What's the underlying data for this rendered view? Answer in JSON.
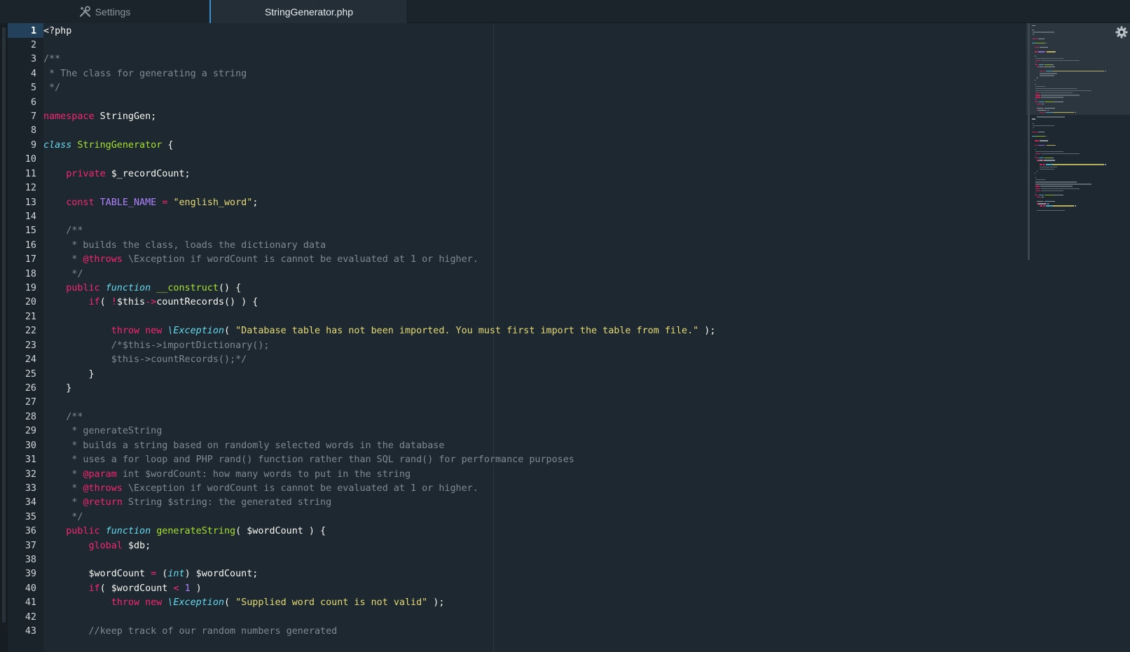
{
  "tabs": [
    {
      "label": "Settings",
      "icon": "tools-icon",
      "active": false
    },
    {
      "label": "StringGenerator.php",
      "icon": "",
      "active": true
    }
  ],
  "editor": {
    "current_line": 1,
    "line_numbers": [
      "1",
      "2",
      "3",
      "4",
      "5",
      "6",
      "7",
      "8",
      "9",
      "10",
      "11",
      "12",
      "13",
      "14",
      "15",
      "16",
      "17",
      "18",
      "19",
      "20",
      "21",
      "22",
      "23",
      "24",
      "25",
      "26",
      "27",
      "28",
      "29",
      "30",
      "31",
      "32",
      "33",
      "34",
      "35",
      "36",
      "37",
      "38",
      "39",
      "40",
      "41",
      "42",
      "43"
    ],
    "lines": [
      [
        [
          "<?php",
          "p"
        ]
      ],
      [],
      [
        [
          "/**",
          "c"
        ]
      ],
      [
        [
          " * The class for generating a string",
          "c"
        ]
      ],
      [
        [
          " */",
          "c"
        ]
      ],
      [],
      [
        [
          "namespace",
          "k"
        ],
        [
          " StringGen;",
          "p"
        ]
      ],
      [],
      [
        [
          "class",
          "it"
        ],
        [
          " ",
          "p"
        ],
        [
          "StringGenerator",
          "g"
        ],
        [
          " {",
          "p"
        ]
      ],
      [],
      [
        [
          "    ",
          "p"
        ],
        [
          "private",
          "k"
        ],
        [
          " $_recordCount;",
          "p"
        ]
      ],
      [],
      [
        [
          "    ",
          "p"
        ],
        [
          "const",
          "k"
        ],
        [
          " ",
          "p"
        ],
        [
          "TABLE_NAME",
          "n"
        ],
        [
          " ",
          "p"
        ],
        [
          "=",
          "k"
        ],
        [
          " ",
          "p"
        ],
        [
          "\"english_word\"",
          "s"
        ],
        [
          ";",
          "p"
        ]
      ],
      [],
      [
        [
          "    /**",
          "c"
        ]
      ],
      [
        [
          "     * builds the class, loads the dictionary data",
          "c"
        ]
      ],
      [
        [
          "     * ",
          "c"
        ],
        [
          "@throws",
          "k"
        ],
        [
          " \\Exception if wordCount is cannot be evaluated at 1 or higher.",
          "c"
        ]
      ],
      [
        [
          "     */",
          "c"
        ]
      ],
      [
        [
          "    ",
          "p"
        ],
        [
          "public",
          "k"
        ],
        [
          " ",
          "p"
        ],
        [
          "function",
          "it"
        ],
        [
          " ",
          "p"
        ],
        [
          "__construct",
          "g"
        ],
        [
          "() {",
          "p"
        ]
      ],
      [
        [
          "        ",
          "p"
        ],
        [
          "if",
          "k"
        ],
        [
          "( ",
          "p"
        ],
        [
          "!",
          "k"
        ],
        [
          "$this",
          "p"
        ],
        [
          "->",
          "k"
        ],
        [
          "countRecords() ) {",
          "p"
        ]
      ],
      [],
      [
        [
          "            ",
          "p"
        ],
        [
          "throw",
          "k"
        ],
        [
          " ",
          "p"
        ],
        [
          "new",
          "k"
        ],
        [
          " ",
          "p"
        ],
        [
          "\\Exception",
          "it"
        ],
        [
          "( ",
          "p"
        ],
        [
          "\"Database table has not been imported. You must first import the table from file.\"",
          "s"
        ],
        [
          " );",
          "p"
        ]
      ],
      [
        [
          "            /*$this->importDictionary();",
          "c"
        ]
      ],
      [
        [
          "            $this->countRecords();*/",
          "c"
        ]
      ],
      [
        [
          "        }",
          "p"
        ]
      ],
      [
        [
          "    }",
          "p"
        ]
      ],
      [],
      [
        [
          "    /**",
          "c"
        ]
      ],
      [
        [
          "     * generateString",
          "c"
        ]
      ],
      [
        [
          "     * builds a string based on randomly selected words in the database",
          "c"
        ]
      ],
      [
        [
          "     * uses a for loop and PHP rand() function rather than SQL rand() for performance purposes",
          "c"
        ]
      ],
      [
        [
          "     * ",
          "c"
        ],
        [
          "@param",
          "k"
        ],
        [
          " int $wordCount: how many words to put in the string",
          "c"
        ]
      ],
      [
        [
          "     * ",
          "c"
        ],
        [
          "@throws",
          "k"
        ],
        [
          " \\Exception if wordCount is cannot be evaluated at 1 or higher.",
          "c"
        ]
      ],
      [
        [
          "     * ",
          "c"
        ],
        [
          "@return",
          "k"
        ],
        [
          " String $string: the generated string",
          "c"
        ]
      ],
      [
        [
          "     */",
          "c"
        ]
      ],
      [
        [
          "    ",
          "p"
        ],
        [
          "public",
          "k"
        ],
        [
          " ",
          "p"
        ],
        [
          "function",
          "it"
        ],
        [
          " ",
          "p"
        ],
        [
          "generateString",
          "g"
        ],
        [
          "( $wordCount ) {",
          "p"
        ]
      ],
      [
        [
          "        ",
          "p"
        ],
        [
          "global",
          "k"
        ],
        [
          " $db;",
          "p"
        ]
      ],
      [],
      [
        [
          "        $wordCount ",
          "p"
        ],
        [
          "=",
          "k"
        ],
        [
          " (",
          "p"
        ],
        [
          "int",
          "it"
        ],
        [
          ") $wordCount;",
          "p"
        ]
      ],
      [
        [
          "        ",
          "p"
        ],
        [
          "if",
          "k"
        ],
        [
          "( $wordCount ",
          "p"
        ],
        [
          "<",
          "k"
        ],
        [
          " ",
          "p"
        ],
        [
          "1",
          "n"
        ],
        [
          " )",
          "p"
        ]
      ],
      [
        [
          "            ",
          "p"
        ],
        [
          "throw",
          "k"
        ],
        [
          " ",
          "p"
        ],
        [
          "new",
          "k"
        ],
        [
          " ",
          "p"
        ],
        [
          "\\Exception",
          "it"
        ],
        [
          "( ",
          "p"
        ],
        [
          "\"Supplied word count is not valid\"",
          "s"
        ],
        [
          " );",
          "p"
        ]
      ],
      [],
      [
        [
          "        //keep track of our random numbers generated",
          "c"
        ]
      ]
    ]
  },
  "colors": {
    "background": "#1e2830",
    "keyword": "#f92672",
    "storage_italic": "#66d9ef",
    "entity": "#a6e22e",
    "string": "#e6db74",
    "constant": "#ae81ff",
    "comment": "#7f8a91",
    "accent": "#3a8fd1"
  },
  "minimap": {
    "icon": "gear-icon"
  }
}
